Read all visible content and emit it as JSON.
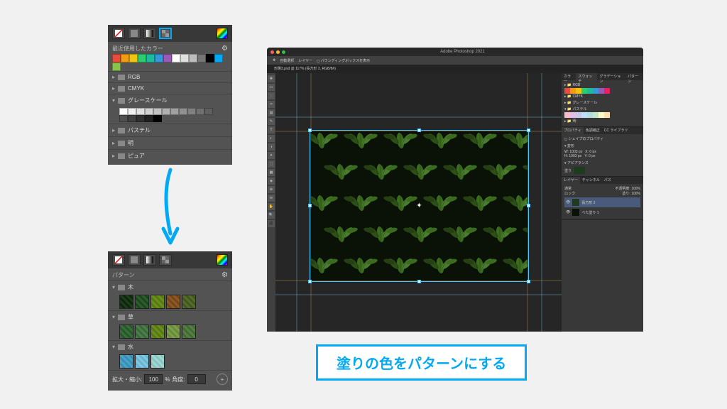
{
  "swatch_panel": {
    "recent_label": "最近使用したカラー",
    "recent_colors": [
      "#e74c3c",
      "#f39c12",
      "#f1c40f",
      "#2ecc71",
      "#1abc9c",
      "#3498db",
      "#9b59b6",
      "#ffffff",
      "#e0e0e0",
      "#bdbdbd",
      "#757575",
      "#000000",
      "#03a9f4",
      "#8bc34a"
    ],
    "groups": [
      {
        "label": "RGB",
        "open": false
      },
      {
        "label": "CMYK",
        "open": false
      },
      {
        "label": "グレースケール",
        "open": true,
        "grays": [
          "#ffffff",
          "#f0f0f0",
          "#e0e0e0",
          "#d0d0d0",
          "#c0c0c0",
          "#b0b0b0",
          "#a0a0a0",
          "#909090",
          "#808080",
          "#707070",
          "#606060",
          "#505050",
          "#404040",
          "#303030",
          "#202020",
          "#000000"
        ]
      },
      {
        "label": "パステル",
        "open": false
      },
      {
        "label": "明",
        "open": false
      },
      {
        "label": "ピュア",
        "open": false
      }
    ]
  },
  "pattern_panel": {
    "label": "パターン",
    "groups": [
      {
        "label": "木",
        "thumbs": [
          "#1e3b1e",
          "#2f5a2f",
          "#6b8e23",
          "#8b5a2b",
          "#556b2f"
        ]
      },
      {
        "label": "草",
        "thumbs": [
          "#3a6b3a",
          "#4d7c4d",
          "#6b8e23",
          "#7c9e4d",
          "#567d46"
        ]
      },
      {
        "label": "水",
        "thumbs": [
          "#4aa3c7",
          "#7ec8e3",
          "#9dd9d2"
        ]
      }
    ],
    "scale_label": "拡大・縮小:",
    "scale_value": "100",
    "scale_unit": "%",
    "angle_label": "角度:",
    "angle_value": "0"
  },
  "photoshop": {
    "title": "Adobe Photoshop 2021",
    "opts": [
      "自動選択",
      "レイヤー",
      "◻ バウンディングボックスを表示"
    ],
    "tab": "形態3.psd @ 117% (長方形 2, RGB/8#) ",
    "right_tabs": {
      "swatch": [
        "カラー",
        "スウォッチ",
        "グラデーション",
        "パターン"
      ],
      "swatch_groups": [
        "RGB",
        "CMYK",
        "グレースケール",
        "パステル",
        "明"
      ],
      "prop": [
        "プロパティ",
        "色調補正",
        "CC ライブラリ"
      ],
      "shape": "シェイプのプロパティ",
      "transform": "変形",
      "w": "W: 1003 px",
      "x": "X: 0 px",
      "h": "H: 1003 px",
      "ypos": "Y: 0 px",
      "appearance": "アピアランス",
      "fill": "塗り",
      "layers_tab": [
        "レイヤー",
        "チャンネル",
        "パス"
      ],
      "blend": "通常",
      "opacity": "不透明度: 100%",
      "lock": "ロック:",
      "fill_pct": "塗り: 100%",
      "layer_items": [
        "長方形 2",
        "べた塗り 1"
      ]
    }
  },
  "callout_text": "塗りの色をパターンにする"
}
